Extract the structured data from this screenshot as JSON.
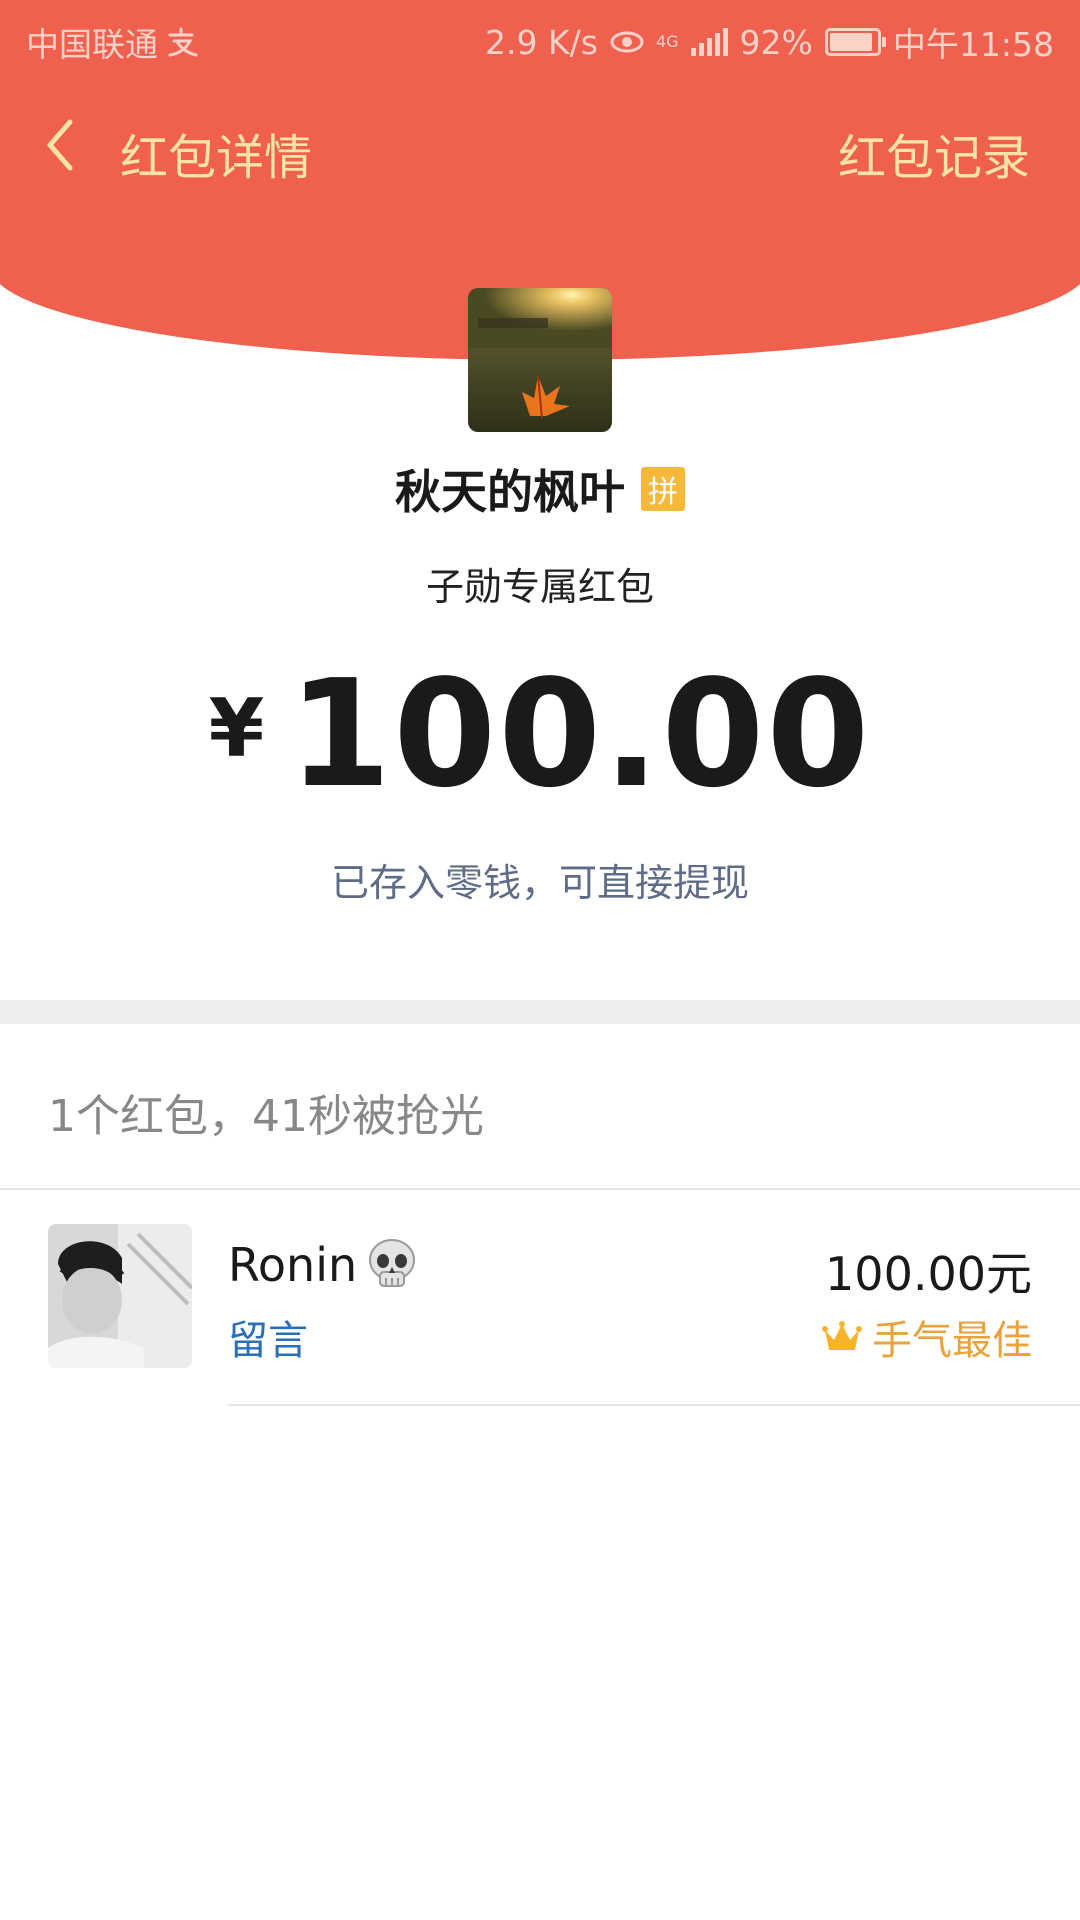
{
  "status_bar": {
    "carrier": "中国联通",
    "network_speed": "2.9 K/s",
    "network_type": "4G",
    "battery": "92%",
    "battery_level": 0.92,
    "time": "中午11:58"
  },
  "nav": {
    "title": "红包详情",
    "records_link": "红包记录"
  },
  "sender": {
    "name": "秋天的枫叶",
    "badge": "拼",
    "greeting": "子勋专属红包"
  },
  "amount": {
    "currency": "¥",
    "value": "100.00",
    "note": "已存入零钱，可直接提现"
  },
  "summary": "1个红包，41秒被抢光",
  "records": [
    {
      "name": "Ronin",
      "message_link": "留言",
      "amount": "100.00元",
      "badge": "手气最佳"
    }
  ],
  "colors": {
    "header_red": "#f0604f",
    "header_text": "#fbe3a8",
    "link_blue": "#2b6fb7",
    "best_gold": "#e8a33d",
    "note_gray_blue": "#5e6c88"
  },
  "icons": [
    "back-chevron-icon",
    "alipay-icon",
    "eye-icon",
    "signal-icon",
    "battery-icon",
    "skull-emoji-icon",
    "crown-icon"
  ]
}
